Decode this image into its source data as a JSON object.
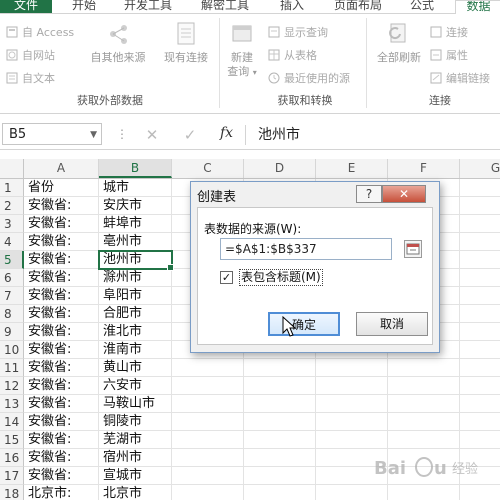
{
  "ribbon": {
    "tabs": [
      "文件",
      "开始",
      "开发工具",
      "解密工具",
      "插入",
      "页面布局",
      "公式",
      "数据"
    ],
    "active_tab": "数据",
    "groups": {
      "external": {
        "title": "获取外部数据",
        "access": "自 Access",
        "web": "自网站",
        "text": "自文本",
        "other_sources": "自其他来源",
        "existing_connections": "现有连接"
      },
      "transform": {
        "title": "获取和转换",
        "new_query_line1": "新建",
        "new_query_line2": "查询",
        "show_queries": "显示查询",
        "from_table": "从表格",
        "recent_sources": "最近使用的源"
      },
      "connections": {
        "title": "连接",
        "refresh_all": "全部刷新",
        "connections": "连接",
        "properties": "属性",
        "edit_links": "编辑链接"
      }
    }
  },
  "formula_bar": {
    "name_box": "B5",
    "fx": "fx",
    "value": "池州市"
  },
  "grid": {
    "columns": [
      "A",
      "B",
      "C",
      "D",
      "E",
      "F",
      "G"
    ],
    "selected_cell": "B5",
    "rows": [
      {
        "n": "1",
        "a": "省份",
        "b": "城市"
      },
      {
        "n": "2",
        "a": "安徽省:",
        "b": "安庆市"
      },
      {
        "n": "3",
        "a": "安徽省:",
        "b": "蚌埠市"
      },
      {
        "n": "4",
        "a": "安徽省:",
        "b": "亳州市"
      },
      {
        "n": "5",
        "a": "安徽省:",
        "b": "池州市"
      },
      {
        "n": "6",
        "a": "安徽省:",
        "b": "滁州市"
      },
      {
        "n": "7",
        "a": "安徽省:",
        "b": "阜阳市"
      },
      {
        "n": "8",
        "a": "安徽省:",
        "b": "合肥市"
      },
      {
        "n": "9",
        "a": "安徽省:",
        "b": "淮北市"
      },
      {
        "n": "10",
        "a": "安徽省:",
        "b": "淮南市"
      },
      {
        "n": "11",
        "a": "安徽省:",
        "b": "黄山市"
      },
      {
        "n": "12",
        "a": "安徽省:",
        "b": "六安市"
      },
      {
        "n": "13",
        "a": "安徽省:",
        "b": "马鞍山市"
      },
      {
        "n": "14",
        "a": "安徽省:",
        "b": "铜陵市"
      },
      {
        "n": "15",
        "a": "安徽省:",
        "b": "芜湖市"
      },
      {
        "n": "16",
        "a": "安徽省:",
        "b": "宿州市"
      },
      {
        "n": "17",
        "a": "安徽省:",
        "b": "宣城市"
      },
      {
        "n": "18",
        "a": "北京市:",
        "b": "北京市"
      }
    ]
  },
  "dialog": {
    "title": "创建表",
    "help": "?",
    "close": "✕",
    "source_label": "表数据的来源(W):",
    "source_value": "=$A$1:$B$337",
    "has_headers_label": "表包含标题(M)",
    "has_headers_checked": true,
    "ok": "确定",
    "cancel": "取消"
  },
  "watermark": "Baidu 经验",
  "colors": {
    "excel_green": "#217346",
    "dialog_border": "#7a9cc6",
    "close_red": "#c7503a"
  }
}
